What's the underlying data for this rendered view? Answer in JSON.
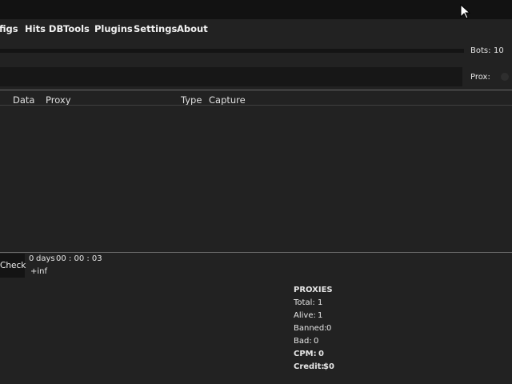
{
  "menu": {
    "items": [
      "figs",
      "Hits DB",
      "Tools",
      "Plugins",
      "Settings",
      "About"
    ]
  },
  "progress": {
    "fraction": 0.0
  },
  "bots": {
    "label": "Bots:",
    "value": "10"
  },
  "proxy_toggle": {
    "label": "Prox:"
  },
  "grid": {
    "columns": [
      "Data",
      "Proxy",
      "Type",
      "Capture"
    ]
  },
  "runner": {
    "check_label": "Check",
    "elapsed_days": "0",
    "days_label": "days",
    "elapsed_time": "00 : 00 : 03",
    "remaining": "+inf"
  },
  "stats": {
    "heading": "PROXIES",
    "total_label": "Total:",
    "total_value": "1",
    "alive_label": "Alive:",
    "alive_value": "1",
    "banned_label": "Banned:",
    "banned_value": "0",
    "bad_label": "Bad:",
    "bad_value": "0",
    "cpm_label": "CPM:",
    "cpm_value": "0",
    "credit_label": "Credit:",
    "credit_value": "$0"
  },
  "colors": {
    "background": "#222222",
    "titlebar": "#121212",
    "field": "#171717",
    "separator": "#6a6a6a"
  }
}
